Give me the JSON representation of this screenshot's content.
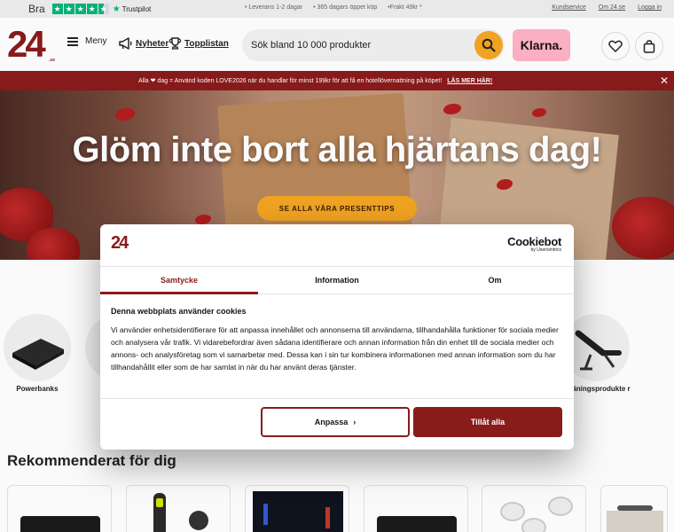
{
  "topbar": {
    "rating_label": "Bra",
    "trustpilot_label": "Trustpilot",
    "usps": [
      "• Leverans 1-2 dagar",
      "• 365 dagars öppet köp",
      "•Frakt 49kr *"
    ],
    "links": [
      "Kundservice",
      "Om 24.se",
      "Logga in"
    ]
  },
  "header": {
    "logo_text": "24",
    "logo_suffix": ".se",
    "menu_label": "Meny",
    "nav": [
      {
        "label": "Nyheter",
        "icon": "megaphone-icon"
      },
      {
        "label": "Topplistan",
        "icon": "trophy-icon"
      }
    ],
    "search_placeholder": "Sök bland 10 000 produkter",
    "klarna_label": "Klarna."
  },
  "promo": {
    "text": "Alla ❤ dag = Använd koden LOVE2026 när du handlar för minst 199kr för att få en hotellövernattning på köpet!",
    "link": "LÄS MER HÄR!"
  },
  "hero": {
    "title": "Glöm inte bort alla hjärtans dag!",
    "button": "SE ALLA VÅRA PRESENTTIPS"
  },
  "categories": [
    {
      "label": "Powerbanks"
    },
    {
      "label": "äningsprodukte r"
    }
  ],
  "recommended": {
    "title": "Rekommenderat för dig"
  },
  "cookie_dialog": {
    "logo_text": "24",
    "brand": "Cookiebot",
    "brand_sub": "by Usercentrics",
    "tabs": [
      "Samtycke",
      "Information",
      "Om"
    ],
    "heading": "Denna webbplats använder cookies",
    "body": "Vi använder enhetsidentifierare för att anpassa innehållet och annonserna till användarna, tillhandahålla funktioner för sociala medier och analysera vår trafik. Vi vidarebefordrar även sådana identifierare och annan information från din enhet till de sociala medier och annons- och analysföretag som vi samarbetar med. Dessa kan i sin tur kombinera informationen med annan information som du har tillhandahållit eller som de har samlat in när du har använt deras tjänster.",
    "customize_label": "Anpassa",
    "allow_label": "Tillåt alla"
  },
  "colors": {
    "brand": "#8a1b1b",
    "accent": "#f5a623",
    "klarna": "#ffb3c7",
    "trustpilot": "#00b67a"
  }
}
